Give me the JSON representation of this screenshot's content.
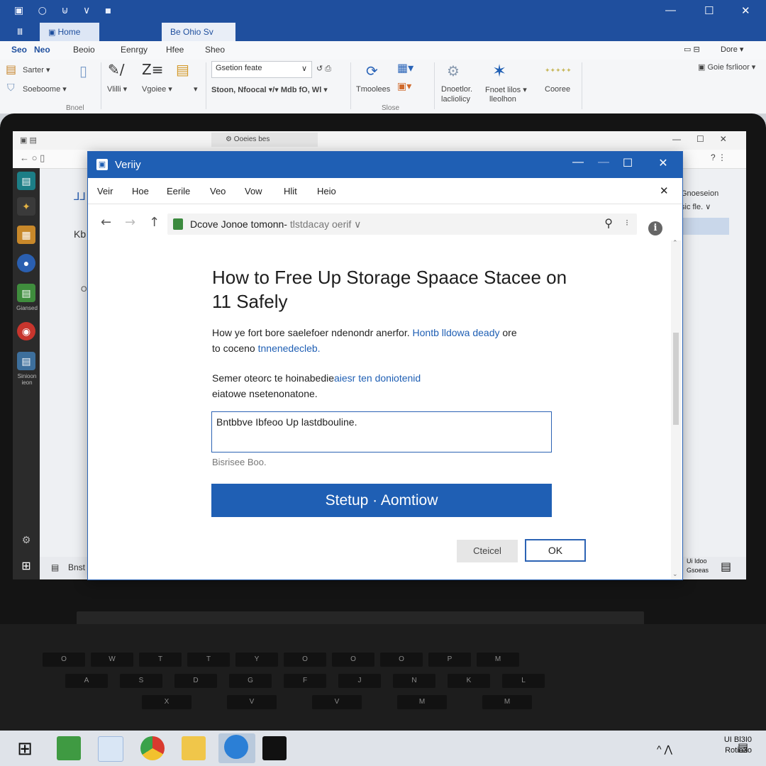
{
  "host": {
    "tabs": [
      "Ⅲ",
      "Home",
      "Be Ohio Sv"
    ],
    "menu": [
      "Seo",
      "Neo",
      "Beoio",
      "Eenrgy",
      "Hfee",
      "Sheo"
    ],
    "ribbon": {
      "clip_label": "Sarter ▾",
      "clip_label2": "Soeboome ▾",
      "group1": "Bnoel",
      "viu": "Vlilli ▾",
      "voice": "Vgoiee ▾",
      "combo1": "Gsetion feate",
      "combo2": "Stoon, Nfoocal ▾/▾  Mdb  fO, Wl ▾",
      "tools": "Tmoolees",
      "group2": "Slose",
      "desc1": "Dnoetlor.",
      "desc1b": "lacliolicy",
      "fine": "Fnoet lilos ▾",
      "fine2": "lleolhon",
      "coone": "Cooree",
      "stars": "✦✦✦✦✦",
      "right1": "Dore ▾",
      "right2": "Goie fsrlioor ▾"
    },
    "window_controls": [
      "—",
      "☐",
      "✕"
    ]
  },
  "background_app": {
    "title": "Ooeies bes",
    "right_panel": [
      "Gnoeseion",
      "sic fle. ∨"
    ],
    "side_labels": [
      "Giansed",
      "Sinioon ieon"
    ],
    "bottom_text": "Bnst",
    "tray_text": [
      "Ui Idoo",
      "Gsoeas"
    ],
    "faint_texts": [
      "Kb",
      "Oi"
    ]
  },
  "dialog": {
    "title": "Veriiy",
    "menu": [
      "Veir",
      "Hoe",
      "Eerile",
      "Veo",
      "Vow",
      "Hlit",
      "Heio"
    ],
    "address": {
      "main": "Dcove Jonoe tomonn-",
      "sub": "tlstdacay oerif ∨"
    },
    "heading": "How to Free Up Storage Spaace Stacee on 11 Safely",
    "para1_a": "How ye fort bore saelefoer ndenondr anerfor.",
    "para1_link": "Hontb lldowa deady",
    "para1_b": "ore",
    "para1_c": "to coceno",
    "para1_link2": "tnnenedecleb.",
    "para2_a": "Semer oteorc te hoinabedie",
    "para2_link": "aiesr ten doniotenid",
    "para2_b": "eiatowe nsetenonatone.",
    "input_value": "Bntbbve Ibfeoo Up lastdbouline.",
    "hint": "Bisrisee Boo.",
    "primary_button": "Stetup · Aomtiow",
    "cancel_button": "Cteicel",
    "ok_button": "OK"
  },
  "keyboard": {
    "row1": [
      "O",
      "W",
      "T",
      "T",
      "Y",
      "O",
      "O",
      "O",
      "P",
      "M"
    ],
    "row2": [
      "A",
      "S",
      "D",
      "G",
      "F",
      "J",
      "N",
      "K",
      "L"
    ],
    "row3": [
      "X",
      "V",
      "V",
      "M",
      "M"
    ]
  },
  "taskbar": {
    "tray_line1": "UI Bl3I0",
    "tray_line2": "Rotio3o",
    "arrows": "^ ⋀"
  }
}
